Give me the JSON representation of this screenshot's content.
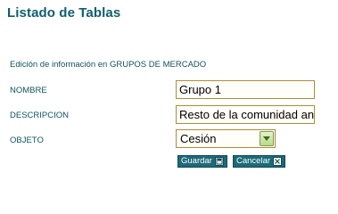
{
  "page": {
    "title": "Listado de Tablas"
  },
  "form": {
    "section_title": "Edición de información en GRUPOS DE MERCADO",
    "nombre_label": "NOMBRE",
    "nombre_value": "Grupo 1",
    "descripcion_label": "DESCRIPCION",
    "descripcion_value": "Resto de la comunidad andaluza",
    "objeto_label": "OBJETO",
    "objeto_value": "Cesión"
  },
  "buttons": {
    "save_label": "Guardar",
    "save_icon": "save-icon",
    "cancel_label": "Cancelar",
    "cancel_icon": "close-icon"
  },
  "colors": {
    "title": "#0e5f6d",
    "button_bg": "#1d6a78",
    "input_border": "#b48a3a"
  }
}
